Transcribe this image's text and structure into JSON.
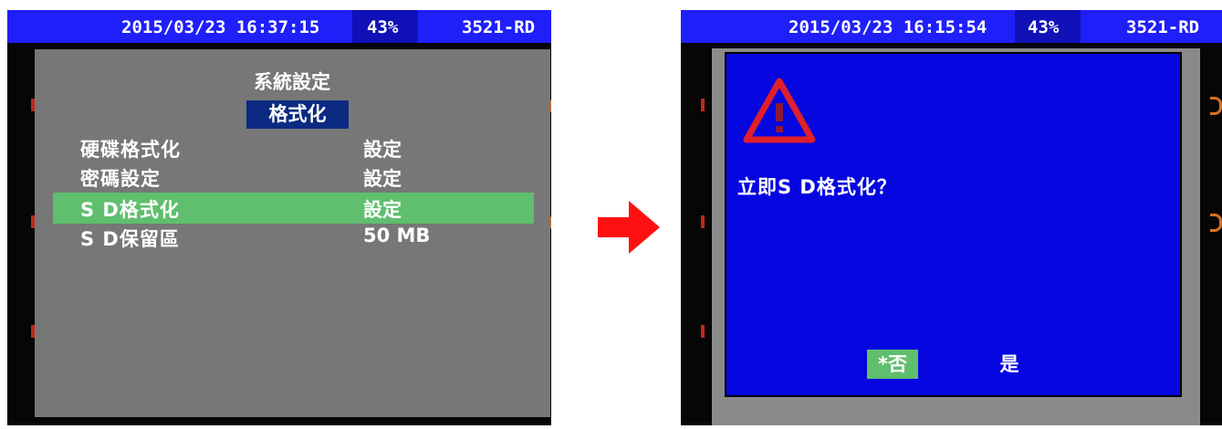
{
  "left_screen": {
    "status": {
      "datetime": "2015/03/23 16:37:15",
      "battery": "43%",
      "device_id": "3521-RD"
    },
    "menu": {
      "title": "系統設定",
      "subtitle": "格式化",
      "rows": [
        {
          "label": "硬碟格式化",
          "value": "設定"
        },
        {
          "label": "密碼設定",
          "value": "設定"
        },
        {
          "label": "S D格式化",
          "value": "設定",
          "selected": true
        },
        {
          "label": "S D保留區",
          "value": "50 MB"
        }
      ]
    }
  },
  "right_screen": {
    "status": {
      "datetime": "2015/03/23 16:15:54",
      "battery": "43%",
      "device_id": "3521-RD"
    },
    "dialog": {
      "question": "立即S D格式化？",
      "no_label": "*否",
      "yes_label": "是",
      "icon": "warning-triangle-icon"
    }
  },
  "colors": {
    "status_bar": "#1f1ffa",
    "menu_bg": "#777777",
    "selected_row": "#5fbf6e",
    "dialog_bg": "#0606e0",
    "arrow": "#ff1010",
    "warning": "#e0202a"
  }
}
